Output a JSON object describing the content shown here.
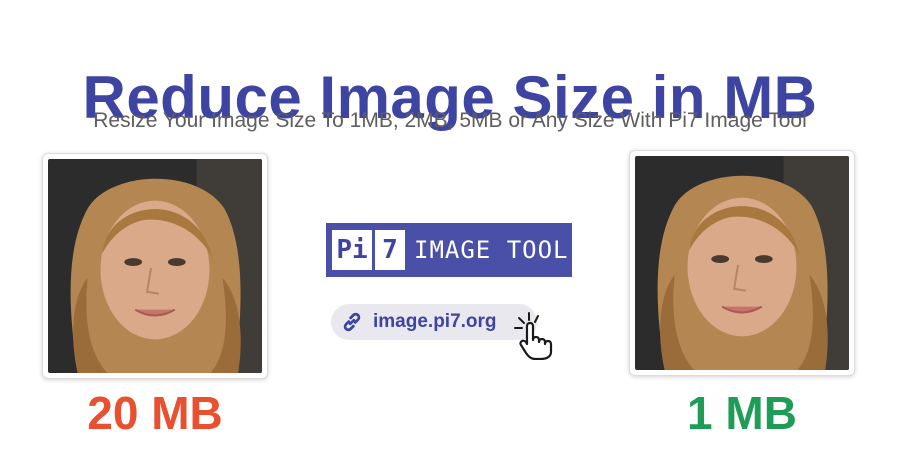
{
  "header": {
    "title": "Reduce Image Size in MB",
    "subtitle": "Resize Your Image Size To 1MB, 2MB, 5MB or Any Size With Pi7 Image Tool"
  },
  "comparison": {
    "before": {
      "size_label": "20 MB",
      "color": "#e8502f"
    },
    "after": {
      "size_label": "1 MB",
      "color": "#1f9d57"
    }
  },
  "logo": {
    "part1": "Pi",
    "part2": "7",
    "text": "IMAGE TOOL"
  },
  "link": {
    "url": "image.pi7.org",
    "icon": "link-icon",
    "cursor_icon": "hand-pointer-icon"
  },
  "colors": {
    "brand": "#3d44a2",
    "subtitle": "#5e5e5e"
  }
}
